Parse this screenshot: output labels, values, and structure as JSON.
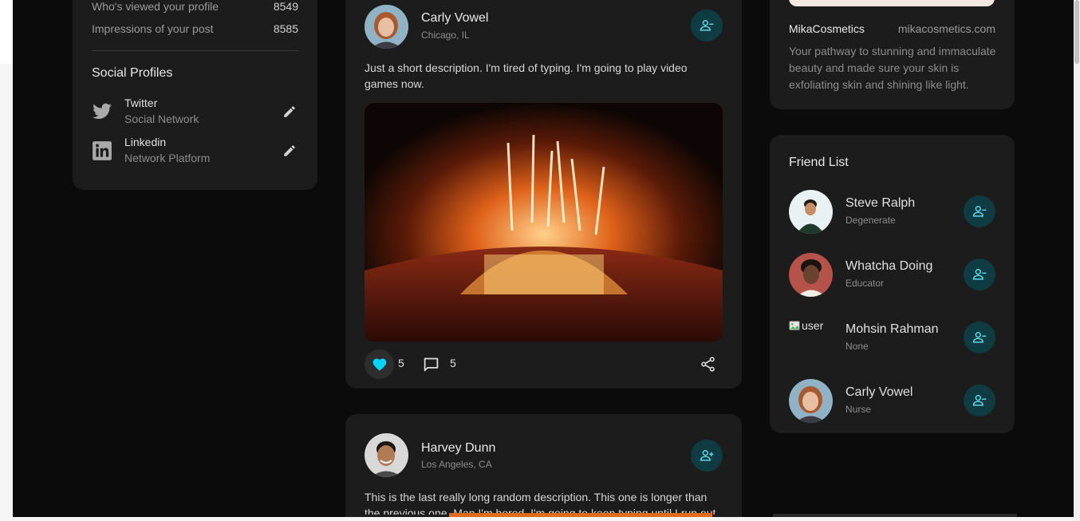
{
  "stats": [
    {
      "label": "Who's viewed your profile",
      "value": "8549"
    },
    {
      "label": "Impressions of your post",
      "value": "8585"
    }
  ],
  "social": {
    "title": "Social Profiles",
    "items": [
      {
        "name": "Twitter",
        "sub": "Social Network",
        "icon": "twitter-icon"
      },
      {
        "name": "Linkedin",
        "sub": "Network Platform",
        "icon": "linkedin-icon"
      }
    ]
  },
  "posts": [
    {
      "name": "Carly Vowel",
      "location": "Chicago, IL",
      "text": "Just a short description. I'm tired of typing. I'm going to play video games now.",
      "likes": "5",
      "comments": "5",
      "follow_icon": "person-remove-icon"
    },
    {
      "name": "Harvey Dunn",
      "location": "Los Angeles, CA",
      "text": "This is the last really long random description. This one is longer than the previous one. Man I'm bored. I'm going to keep typing until I run out of",
      "follow_icon": "person-add-icon"
    }
  ],
  "brand": {
    "name": "MikaCosmetics",
    "url": "mikacosmetics.com",
    "description": "Your pathway to stunning and immaculate beauty and made sure your skin is exfoliating skin and shining like light."
  },
  "friends": {
    "title": "Friend List",
    "items": [
      {
        "name": "Steve Ralph",
        "sub": "Degenerate"
      },
      {
        "name": "Whatcha Doing",
        "sub": "Educator"
      },
      {
        "name": "Mohsin Rahman",
        "sub": "None",
        "alt": "user"
      },
      {
        "name": "Carly Vowel",
        "sub": "Nurse"
      }
    ]
  },
  "colors": {
    "accent": "#00d4ff",
    "button_bg": "#0f3b42",
    "card_bg": "#1c1c1c",
    "page_bg": "#0b0b0b"
  }
}
